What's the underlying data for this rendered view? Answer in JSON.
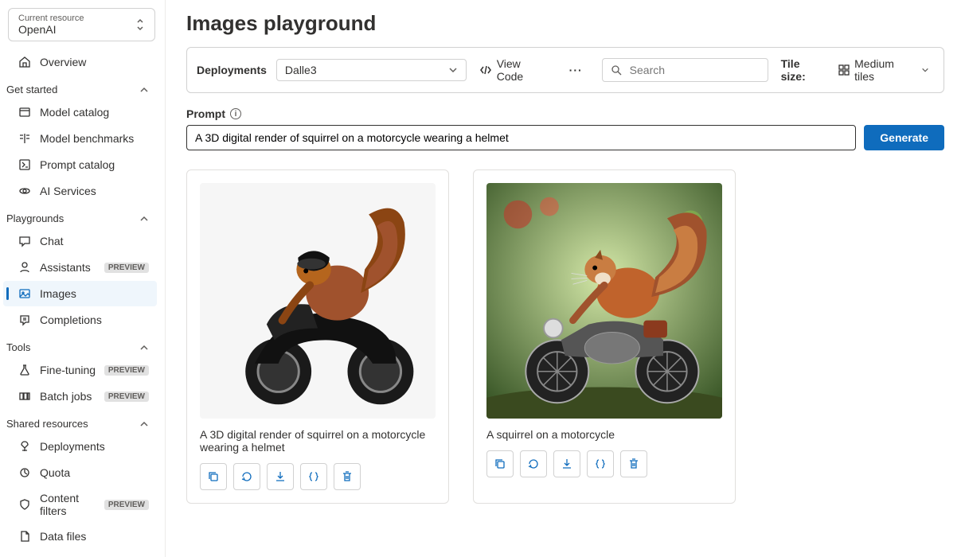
{
  "resource": {
    "label": "Current resource",
    "value": "OpenAI"
  },
  "sidebar": {
    "overview": "Overview",
    "sections": {
      "get_started": {
        "title": "Get started",
        "items": [
          {
            "label": "Model catalog",
            "icon": "catalog-icon"
          },
          {
            "label": "Model benchmarks",
            "icon": "benchmark-icon"
          },
          {
            "label": "Prompt catalog",
            "icon": "prompt-catalog-icon"
          },
          {
            "label": "AI Services",
            "icon": "ai-services-icon"
          }
        ]
      },
      "playgrounds": {
        "title": "Playgrounds",
        "items": [
          {
            "label": "Chat",
            "icon": "chat-icon"
          },
          {
            "label": "Assistants",
            "icon": "assistants-icon",
            "badge": "PREVIEW"
          },
          {
            "label": "Images",
            "icon": "images-icon",
            "active": true
          },
          {
            "label": "Completions",
            "icon": "completions-icon"
          }
        ]
      },
      "tools": {
        "title": "Tools",
        "items": [
          {
            "label": "Fine-tuning",
            "icon": "flask-icon",
            "badge": "PREVIEW"
          },
          {
            "label": "Batch jobs",
            "icon": "batch-icon",
            "badge": "PREVIEW"
          }
        ]
      },
      "shared": {
        "title": "Shared resources",
        "items": [
          {
            "label": "Deployments",
            "icon": "deployments-icon"
          },
          {
            "label": "Quota",
            "icon": "quota-icon"
          },
          {
            "label": "Content filters",
            "icon": "shield-icon",
            "badge": "PREVIEW"
          },
          {
            "label": "Data files",
            "icon": "data-files-icon"
          }
        ]
      }
    }
  },
  "page": {
    "title": "Images playground"
  },
  "toolbar": {
    "deployments_label": "Deployments",
    "deployment_selected": "Dalle3",
    "view_code": "View Code",
    "search_placeholder": "Search",
    "tile_size_label": "Tile size:",
    "tile_size_value": "Medium tiles"
  },
  "prompt": {
    "label": "Prompt",
    "value": "A 3D digital render of squirrel on a motorcycle wearing a helmet",
    "generate": "Generate"
  },
  "cards": [
    {
      "caption": "A 3D digital render of squirrel on a motorcycle wearing a helmet"
    },
    {
      "caption": "A squirrel on a motorcycle"
    }
  ]
}
